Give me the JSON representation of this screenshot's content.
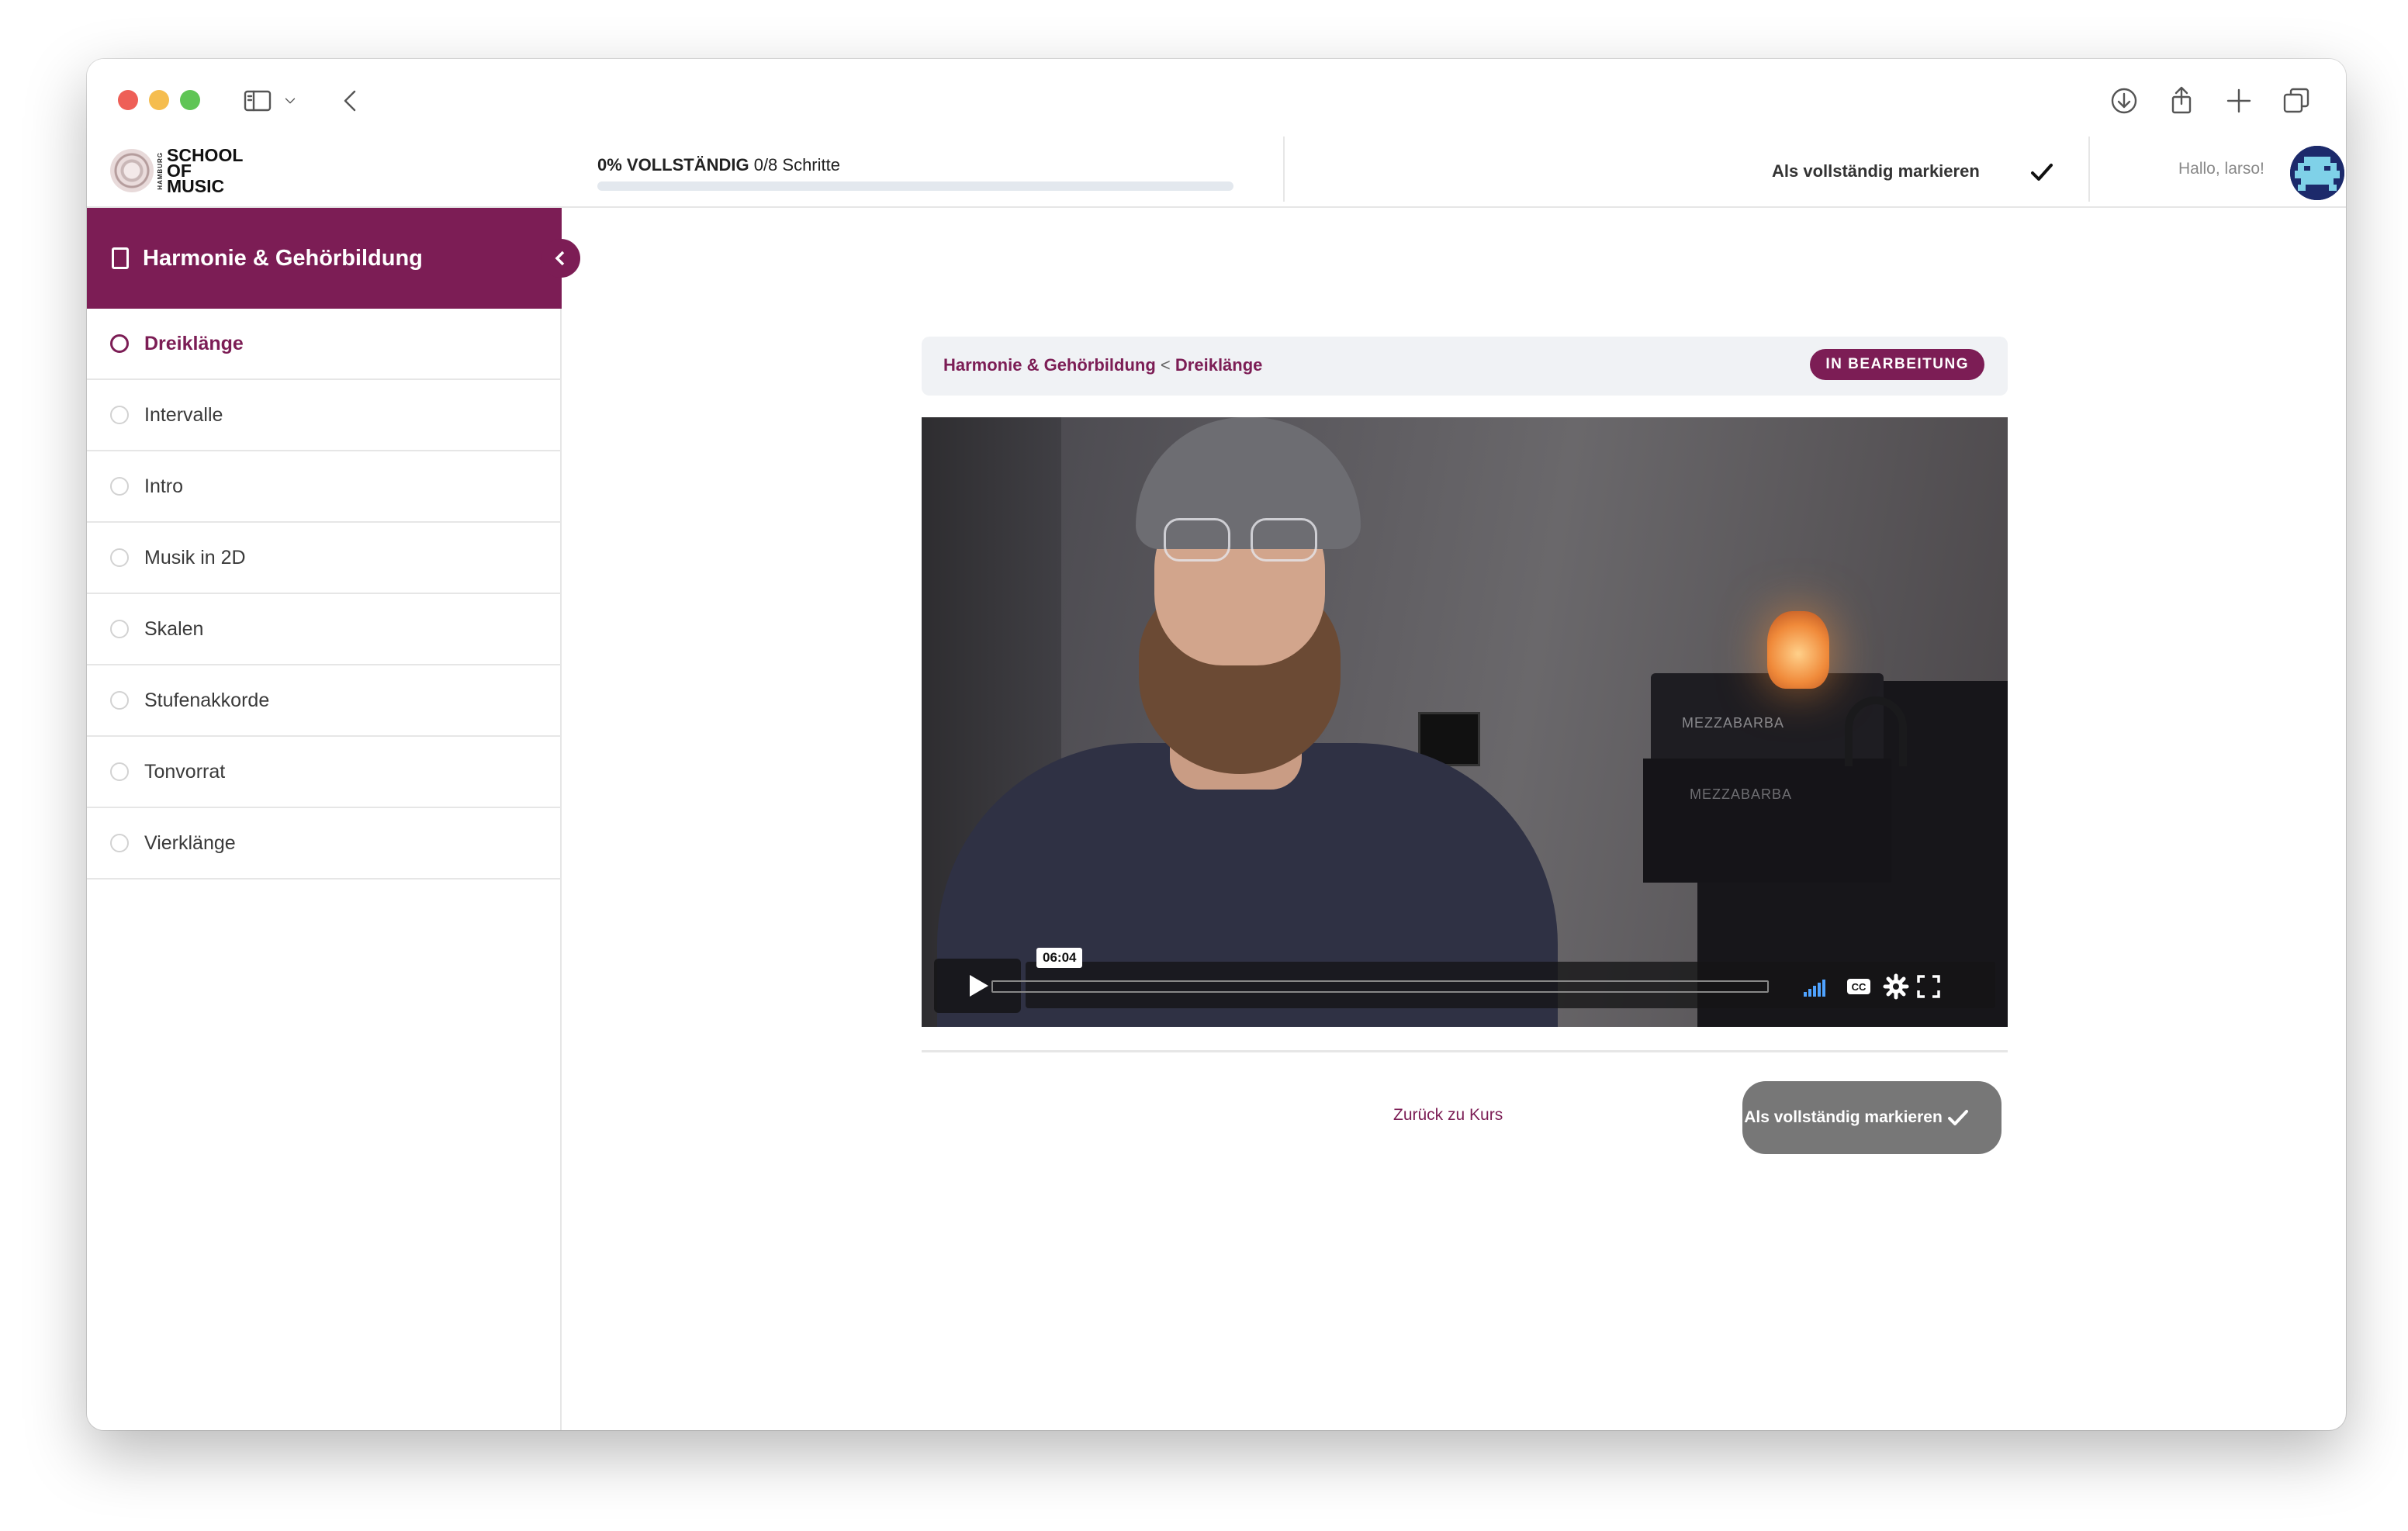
{
  "browser": {
    "icons": [
      "sidebar-toggle-icon",
      "chevron-down-icon",
      "back-arrow-icon",
      "download-icon",
      "share-icon",
      "plus-icon",
      "tabs-overview-icon"
    ]
  },
  "logo": {
    "text_line1": "SCHOOL",
    "text_line2": "OF",
    "text_line3": "MUSIC",
    "vertical_text": "HAMBURG"
  },
  "progress": {
    "percent_label": "0% VOLLSTÄNDIG",
    "steps_label": "0/8 Schritte",
    "fraction": 0
  },
  "header": {
    "mark_complete_label": "Als vollständig markieren",
    "greeting": "Hallo, larso!"
  },
  "sidebar": {
    "course_title": "Harmonie & Gehörbildung",
    "lessons": [
      {
        "label": "Dreiklänge",
        "active": true
      },
      {
        "label": "Intervalle",
        "active": false
      },
      {
        "label": "Intro",
        "active": false
      },
      {
        "label": "Musik in 2D",
        "active": false
      },
      {
        "label": "Skalen",
        "active": false
      },
      {
        "label": "Stufenakkorde",
        "active": false
      },
      {
        "label": "Tonvorrat",
        "active": false
      },
      {
        "label": "Vierklänge",
        "active": false
      }
    ]
  },
  "main": {
    "breadcrumb_course": "Harmonie & Gehörbildung",
    "breadcrumb_separator": "<",
    "breadcrumb_lesson": "Dreiklänge",
    "status_badge": "IN BEARBEITUNG",
    "video": {
      "duration": "06:04",
      "amp_text": "MEZZABARBA"
    },
    "back_link": "Zurück zu Kurs",
    "mark_button_label": "Als vollständig markieren"
  },
  "colors": {
    "brand": "#7c1d55",
    "button_gray": "#777777"
  }
}
